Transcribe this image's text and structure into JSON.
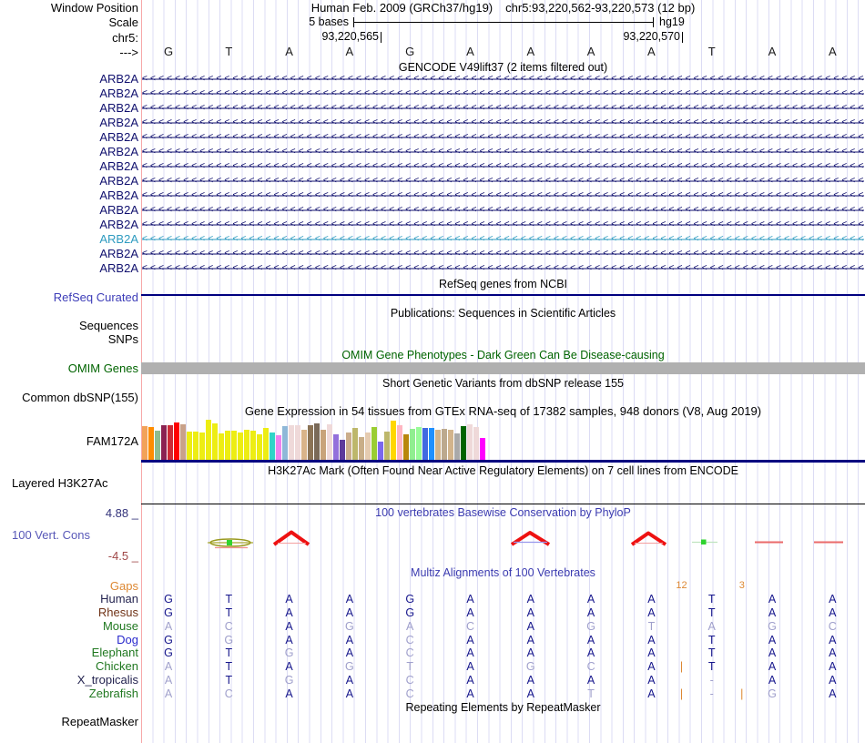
{
  "header": {
    "row_labels": {
      "window_position": "Window Position",
      "scale": "Scale",
      "chrom": "chr5:",
      "direction": "--->"
    },
    "assembly_title": "Human Feb. 2009 (GRCh37/hg19)",
    "region_title": "chr5:93,220,562-93,220,573 (12 bp)",
    "scale_value": "5 bases",
    "scale_right": "hg19",
    "ruler": [
      {
        "text": "93,220,565"
      },
      {
        "text": "93,220,570"
      }
    ],
    "bases": [
      "G",
      "T",
      "A",
      "A",
      "G",
      "A",
      "A",
      "A",
      "A",
      "T",
      "A",
      "A"
    ]
  },
  "gencode": {
    "title": "GENCODE V49lift37 (2 items filtered out)",
    "gene_name": "ARB2A",
    "row_count": 14,
    "highlight_index": 11,
    "normal_color": "#10106e",
    "highlight_color": "#2e9bc0",
    "strand_char": "<"
  },
  "refseq": {
    "title": "RefSeq genes from NCBI",
    "label": "RefSeq Curated",
    "label_color": "#3d3db8",
    "line_color": "#000080"
  },
  "publications": {
    "title": "Publications: Sequences in Scientific Articles",
    "label_sequences": "Sequences",
    "label_snps": "SNPs"
  },
  "omim": {
    "title": "OMIM Gene Phenotypes - Dark Green Can Be Disease-causing",
    "label": "OMIM Genes",
    "color": "#006400",
    "bar_color": "#b0b0b0"
  },
  "dbsnp": {
    "title": "Short Genetic Variants from dbSNP release 155",
    "label": "Common dbSNP(155)"
  },
  "gtex": {
    "title": "Gene Expression in 54 tissues from GTEx RNA-seq of 17382 samples, 948 donors (V8, Aug 2019)",
    "label": "FAM172A",
    "baseline_color": "#000080",
    "bars": [
      [
        "#F2A259",
        37
      ],
      [
        "#FF8C00",
        36
      ],
      [
        "#8FBC8F",
        32
      ],
      [
        "#8B2252",
        38
      ],
      [
        "#CC2A36",
        38
      ],
      [
        "#FF0000",
        41
      ],
      [
        "#C9A189",
        39
      ],
      [
        "#EDED13",
        31
      ],
      [
        "#EDED13",
        31
      ],
      [
        "#EDED13",
        30
      ],
      [
        "#EDED13",
        44
      ],
      [
        "#EDED13",
        40
      ],
      [
        "#EDED13",
        29
      ],
      [
        "#EDED13",
        32
      ],
      [
        "#EDED13",
        32
      ],
      [
        "#EDED13",
        30
      ],
      [
        "#EDED13",
        33
      ],
      [
        "#EDED13",
        32
      ],
      [
        "#EDED13",
        28
      ],
      [
        "#EDED13",
        35
      ],
      [
        "#30D5C8",
        30
      ],
      [
        "#EE82EE",
        27
      ],
      [
        "#8FB8D8",
        37
      ],
      [
        "#EFD9D9",
        38
      ],
      [
        "#EFD9D9",
        38
      ],
      [
        "#D9B48A",
        33
      ],
      [
        "#8B7355",
        38
      ],
      [
        "#7A6A58",
        40
      ],
      [
        "#C8A37A",
        33
      ],
      [
        "#EFD9D9",
        39
      ],
      [
        "#9370DB",
        28
      ],
      [
        "#5D3A9B",
        22
      ],
      [
        "#CBAD8C",
        30
      ],
      [
        "#BDB76B",
        35
      ],
      [
        "#C9AE88",
        25
      ],
      [
        "#E5CBB0",
        30
      ],
      [
        "#9ACD32",
        36
      ],
      [
        "#7B68EE",
        20
      ],
      [
        "#BDB76B",
        31
      ],
      [
        "#FFD700",
        43
      ],
      [
        "#FFB6C1",
        38
      ],
      [
        "#B8860B",
        28
      ],
      [
        "#90EE90",
        34
      ],
      [
        "#98FB98",
        36
      ],
      [
        "#4169E1",
        35
      ],
      [
        "#1E90FF",
        35
      ],
      [
        "#D2B48C",
        33
      ],
      [
        "#BCA98E",
        34
      ],
      [
        "#D2B48C",
        33
      ],
      [
        "#A9A9A9",
        29
      ],
      [
        "#006400",
        37
      ],
      [
        "#EFD9D9",
        39
      ],
      [
        "#EFD9D9",
        36
      ],
      [
        "#FF00FF",
        24
      ]
    ]
  },
  "h3k27ac": {
    "title": "H3K27Ac Mark (Often Found Near Active Regulatory Elements) on 7 cell lines from ENCODE",
    "label": "Layered H3K27Ac"
  },
  "conservation": {
    "title": "100 vertebrates Basewise Conservation by PhyloP",
    "label": "100 Vert. Cons",
    "max_value": "4.88 _",
    "min_value": "-4.5 _",
    "title_color": "#3b3bb0",
    "label_color": "#5858b8",
    "max_color": "#32327a",
    "min_color": "#a04848"
  },
  "multiz": {
    "title": "Multiz Alignments of 100 Vertebrates",
    "gaps_label": "Gaps",
    "gaps_row": [
      null,
      null,
      null,
      null,
      null,
      null,
      null,
      null,
      null,
      "12:g",
      null,
      "3:g",
      null,
      null
    ],
    "match_color": "#16168c",
    "mismatch_color": "#a0a0cc",
    "gap_color": "#dd8833",
    "species": [
      {
        "name": "Human",
        "color": "#242450",
        "seq": [
          "G:m",
          "T:m",
          "A:m",
          "A:m",
          "G:m",
          "A:m",
          "A:m",
          "A:m",
          "A:m",
          null,
          "T:m",
          null,
          "A:m",
          "A:m"
        ]
      },
      {
        "name": "Rhesus",
        "color": "#703418",
        "seq": [
          "G:m",
          "T:m",
          "A:m",
          "A:m",
          "G:m",
          "A:m",
          "A:m",
          "A:m",
          "A:m",
          null,
          "T:m",
          null,
          "A:m",
          "A:m"
        ]
      },
      {
        "name": "Mouse",
        "color": "#207820",
        "seq": [
          "A:x",
          "C:x",
          "A:m",
          "G:x",
          "A:x",
          "C:x",
          "A:m",
          "G:x",
          "T:x",
          null,
          "A:x",
          null,
          "G:x",
          "C:x"
        ]
      },
      {
        "name": "Dog",
        "color": "#2828cc",
        "seq": [
          "G:m",
          "G:x",
          "A:m",
          "A:m",
          "C:x",
          "A:m",
          "A:m",
          "A:m",
          "A:m",
          null,
          "T:m",
          null,
          "A:m",
          "A:m"
        ]
      },
      {
        "name": "Elephant",
        "color": "#207820",
        "seq": [
          "G:m",
          "T:m",
          "G:x",
          "A:m",
          "C:x",
          "A:m",
          "A:m",
          "A:m",
          "A:m",
          null,
          "T:m",
          null,
          "A:m",
          "A:m"
        ]
      },
      {
        "name": "Chicken",
        "color": "#207820",
        "seq": [
          "A:x",
          "T:m",
          "A:m",
          "G:x",
          "T:x",
          "A:m",
          "G:x",
          "C:x",
          "A:m",
          "|:g",
          "T:m",
          null,
          "A:m",
          "A:m"
        ]
      },
      {
        "name": "X_tropicalis",
        "color": "#242450",
        "seq": [
          "A:x",
          "T:m",
          "G:x",
          "A:m",
          "C:x",
          "A:m",
          "A:m",
          "A:m",
          "A:m",
          null,
          "-:x",
          null,
          "A:m",
          "A:m"
        ]
      },
      {
        "name": "Zebrafish",
        "color": "#207820",
        "seq": [
          "A:x",
          "C:x",
          "A:m",
          "A:m",
          "C:x",
          "A:m",
          "A:m",
          "T:x",
          "A:m",
          "|:g",
          "-:x",
          "|:g",
          "G:x",
          "A:m"
        ]
      }
    ]
  },
  "repeatmasker": {
    "title": "Repeating Elements by RepeatMasker",
    "label": "RepeatMasker"
  }
}
